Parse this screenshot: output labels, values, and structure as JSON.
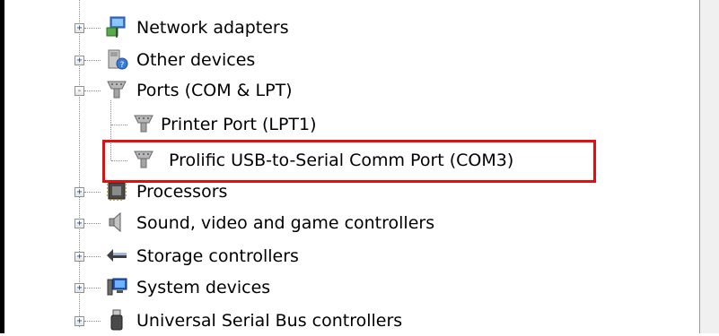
{
  "tree": {
    "items": [
      {
        "label": "Network adapters",
        "icon": "network-adapter-icon",
        "expander": "+"
      },
      {
        "label": "Other devices",
        "icon": "unknown-device-icon",
        "expander": "+"
      },
      {
        "label": "Ports (COM & LPT)",
        "icon": "port-connector-icon",
        "expander": "-"
      },
      {
        "label": "Printer Port (LPT1)",
        "icon": "port-connector-icon"
      },
      {
        "label": "Prolific USB-to-Serial Comm Port (COM3)",
        "icon": "port-connector-icon"
      },
      {
        "label": "Processors",
        "icon": "processor-chip-icon",
        "expander": "+"
      },
      {
        "label": "Sound, video and game controllers",
        "icon": "speaker-icon",
        "expander": "+"
      },
      {
        "label": "Storage controllers",
        "icon": "storage-controller-icon",
        "expander": "+"
      },
      {
        "label": "System devices",
        "icon": "system-device-icon",
        "expander": "+"
      },
      {
        "label": "Universal Serial Bus controllers",
        "icon": "usb-plug-icon",
        "expander": "+"
      }
    ]
  },
  "colors": {
    "highlight_border": "#e01010",
    "tree_line": "#8c8c8c",
    "expander_glyph": "#2b4f8a"
  }
}
